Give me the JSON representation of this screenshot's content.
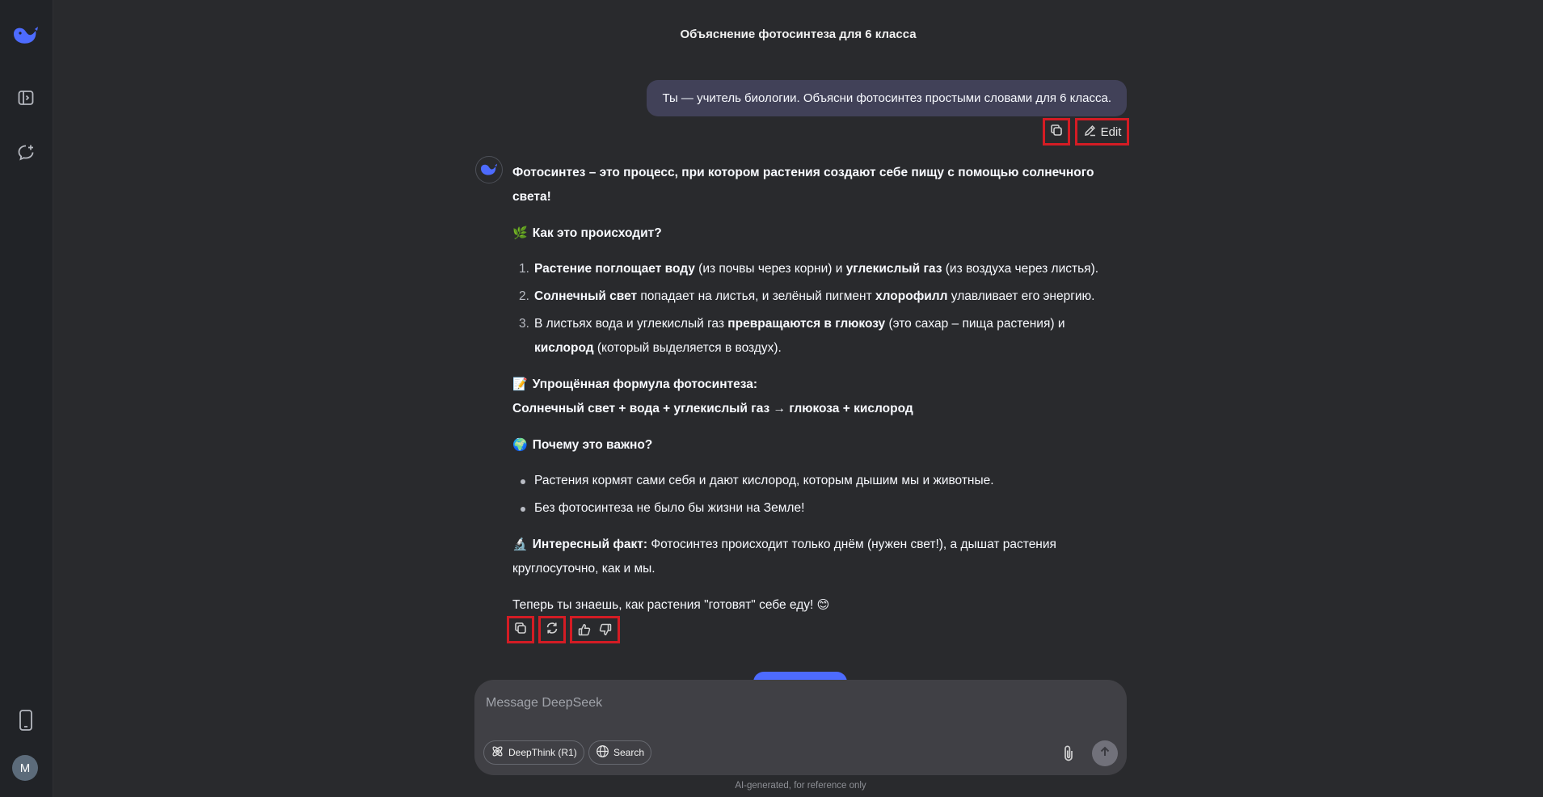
{
  "chat": {
    "title": "Объяснение фотосинтеза для 6 класса"
  },
  "user_message": {
    "text": "Ты — учитель биологии. Объясни фотосинтез простыми словами для 6 класса.",
    "edit_label": "Edit"
  },
  "assistant": {
    "intro_bold": "Фотосинтез – это процесс, при котором растения создают себе пищу с помощью солнечного света!",
    "how_heading": "Как это происходит?",
    "steps": [
      {
        "num": "1.",
        "parts": [
          {
            "t": "Растение поглощает воду",
            "b": true
          },
          {
            "t": " (из почвы через корни) и ",
            "b": false
          },
          {
            "t": "углекислый газ",
            "b": true
          },
          {
            "t": " (из воздуха через листья).",
            "b": false
          }
        ]
      },
      {
        "num": "2.",
        "parts": [
          {
            "t": "Солнечный свет",
            "b": true
          },
          {
            "t": " попадает на листья, и зелёный пигмент ",
            "b": false
          },
          {
            "t": "хлорофилл",
            "b": true
          },
          {
            "t": " улавливает его энергию.",
            "b": false
          }
        ]
      },
      {
        "num": "3.",
        "parts": [
          {
            "t": "В листьях вода и углекислый газ ",
            "b": false
          },
          {
            "t": "превращаются в глюкозу",
            "b": true
          },
          {
            "t": " (это сахар – пища растения) и ",
            "b": false
          },
          {
            "t": "кислород",
            "b": true
          },
          {
            "t": " (который выделяется в воздух).",
            "b": false
          }
        ]
      }
    ],
    "formula_heading": "Упрощённая формула фотосинтеза:",
    "formula": "Солнечный свет + вода + углекислый газ → глюкоза + кислород",
    "why_heading": "Почему это важно?",
    "why_points": [
      "Растения кормят сами себя и дают кислород, которым дышим мы и животные.",
      "Без фотосинтеза не было бы жизни на Земле!"
    ],
    "fact_label": "Интересный факт:",
    "fact_text": " Фотосинтез происходит только днём (нужен свет!), а дышат растения круглосуточно, как и мы.",
    "closing": "Теперь ты знаешь, как растения \"готовят\" себе еду!",
    "emojis": {
      "how": "🌿",
      "formula": "📝",
      "why": "🌍",
      "fact": "🔬",
      "closing": "😊"
    }
  },
  "input": {
    "placeholder": "Message DeepSeek",
    "deepthink_label": "DeepThink (R1)",
    "search_label": "Search"
  },
  "sidebar": {
    "avatar_initial": "M"
  },
  "footer": {
    "disclaimer": "AI-generated, for reference only"
  },
  "icons": {
    "logo": "deepseek-whale-icon",
    "collapse": "sidebar-toggle-icon",
    "new_chat": "new-chat-icon",
    "phone": "mobile-app-icon",
    "copy": "copy-icon",
    "edit": "pencil-icon",
    "regenerate": "refresh-icon",
    "like": "thumbs-up-icon",
    "dislike": "thumbs-down-icon",
    "attach": "paperclip-icon",
    "send": "arrow-up-icon",
    "deepthink": "atom-icon",
    "search": "globe-icon"
  },
  "colors": {
    "accent": "#4d6bfe",
    "highlight_border": "#d41c24",
    "user_bubble": "#414158",
    "background": "#292a2d"
  }
}
